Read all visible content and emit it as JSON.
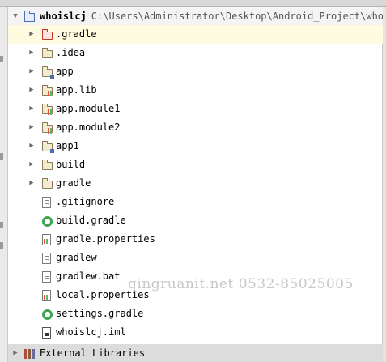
{
  "top_fragment": "…",
  "root": {
    "name": "whoislcj",
    "path": "C:\\Users\\Administrator\\Desktop\\Android_Project\\whois"
  },
  "items": [
    {
      "label": ".gradle",
      "icon": "folder-red-icon",
      "expandable": true,
      "selected": true
    },
    {
      "label": ".idea",
      "icon": "folder-icon",
      "expandable": true
    },
    {
      "label": "app",
      "icon": "module-folder-icon",
      "expandable": true
    },
    {
      "label": "app.lib",
      "icon": "library-module-icon",
      "expandable": true
    },
    {
      "label": "app.module1",
      "icon": "library-module-icon",
      "expandable": true
    },
    {
      "label": "app.module2",
      "icon": "library-module-icon",
      "expandable": true
    },
    {
      "label": "app1",
      "icon": "module-folder-icon",
      "expandable": true
    },
    {
      "label": "build",
      "icon": "folder-icon",
      "expandable": true
    },
    {
      "label": "gradle",
      "icon": "folder-icon",
      "expandable": true
    },
    {
      "label": ".gitignore",
      "icon": "text-file-icon",
      "expandable": false
    },
    {
      "label": "build.gradle",
      "icon": "gradle-file-icon",
      "expandable": false
    },
    {
      "label": "gradle.properties",
      "icon": "properties-file-icon",
      "expandable": false
    },
    {
      "label": "gradlew",
      "icon": "text-file-icon",
      "expandable": false
    },
    {
      "label": "gradlew.bat",
      "icon": "text-file-icon",
      "expandable": false
    },
    {
      "label": "local.properties",
      "icon": "properties-file-icon",
      "expandable": false
    },
    {
      "label": "settings.gradle",
      "icon": "gradle-file-icon",
      "expandable": false
    },
    {
      "label": "whoislcj.iml",
      "icon": "iml-file-icon",
      "expandable": false
    }
  ],
  "external": {
    "label": "External Libraries",
    "icon": "libraries-icon"
  },
  "watermark": "qingruanit.net 0532-85025005",
  "colors": {
    "selected_row": "#fefbe0",
    "root_row": "#f4f4f4",
    "external_row": "#dcdcdc"
  }
}
